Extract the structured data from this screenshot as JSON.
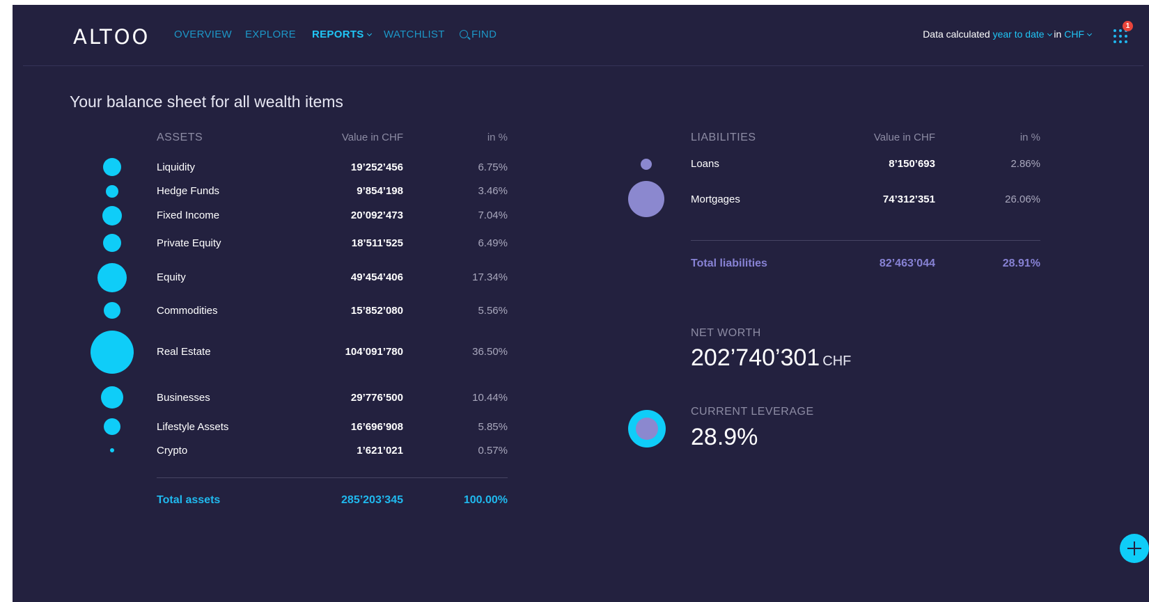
{
  "header": {
    "logo": "ALTOO",
    "nav": [
      {
        "label": "OVERVIEW"
      },
      {
        "label": "EXPLORE"
      },
      {
        "label": "REPORTS"
      },
      {
        "label": "WATCHLIST"
      },
      {
        "label": "FIND"
      }
    ],
    "calc_prefix": "Data calculated",
    "calc_period": "year to date",
    "calc_in": "in",
    "calc_currency": "CHF",
    "notification_count": "1"
  },
  "page_title": "Your balance sheet for all wealth items",
  "assets": {
    "heading": "ASSETS",
    "value_header": "Value in CHF",
    "pct_header": "in %",
    "rows": [
      {
        "name": "Liquidity",
        "value": "19’252’456",
        "pct": "6.75%"
      },
      {
        "name": "Hedge Funds",
        "value": "9’854’198",
        "pct": "3.46%"
      },
      {
        "name": "Fixed Income",
        "value": "20’092’473",
        "pct": "7.04%"
      },
      {
        "name": "Private Equity",
        "value": "18’511’525",
        "pct": "6.49%"
      },
      {
        "name": "Equity",
        "value": "49’454’406",
        "pct": "17.34%"
      },
      {
        "name": "Commodities",
        "value": "15’852’080",
        "pct": "5.56%"
      },
      {
        "name": "Real Estate",
        "value": "104’091’780",
        "pct": "36.50%"
      },
      {
        "name": "Businesses",
        "value": "29’776’500",
        "pct": "10.44%"
      },
      {
        "name": "Lifestyle Assets",
        "value": "16’696’908",
        "pct": "5.85%"
      },
      {
        "name": "Crypto",
        "value": "1’621’021",
        "pct": "0.57%"
      }
    ],
    "total_label": "Total assets",
    "total_value": "285’203’345",
    "total_pct": "100.00%"
  },
  "liabilities": {
    "heading": "LIABILITIES",
    "value_header": "Value in CHF",
    "pct_header": "in %",
    "rows": [
      {
        "name": "Loans",
        "value": "8’150’693",
        "pct": "2.86%"
      },
      {
        "name": "Mortgages",
        "value": "74’312’351",
        "pct": "26.06%"
      }
    ],
    "total_label": "Total liabilities",
    "total_value": "82’463’044",
    "total_pct": "28.91%"
  },
  "net_worth": {
    "label": "NET WORTH",
    "value": "202’740’301",
    "unit": "CHF"
  },
  "leverage": {
    "label": "CURRENT LEVERAGE",
    "value": "28.9%"
  },
  "colors": {
    "background": "#23213f",
    "asset_accent": "#0fcdf8",
    "liability_accent": "#8b88cf",
    "notification": "#e9453b"
  }
}
